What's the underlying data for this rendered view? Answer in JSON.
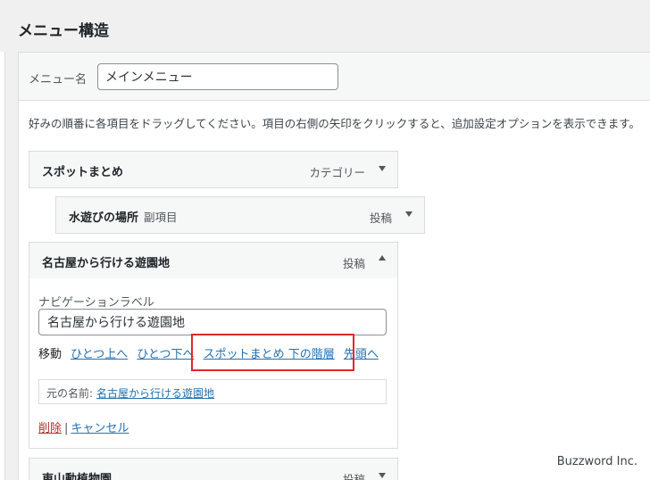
{
  "page": {
    "title": "メニュー構造"
  },
  "menu": {
    "name_label": "メニュー名",
    "name_value": "メインメニュー",
    "instruction": "好みの順番に各項目をドラッグしてください。項目の右側の矢印をクリックすると、追加設定オプションを表示できます。"
  },
  "items": [
    {
      "title": "スポットまとめ",
      "subtitle": "",
      "type": "カテゴリー",
      "expanded": false
    },
    {
      "title": "水遊びの場所",
      "subtitle": "副項目",
      "type": "投稿",
      "expanded": false
    },
    {
      "title": "名古屋から行ける遊園地",
      "subtitle": "",
      "type": "投稿",
      "expanded": true
    },
    {
      "title": "東山動植物園",
      "subtitle": "",
      "type": "投稿",
      "expanded": false
    }
  ],
  "settings": {
    "nav_label_caption": "ナビゲーションラベル",
    "nav_label_value": "名古屋から行ける遊園地",
    "move_label": "移動",
    "move_links": [
      "ひとつ上へ",
      "ひとつ下へ",
      "スポットまとめ 下の階層",
      "先頭へ"
    ],
    "original_caption": "元の名前:",
    "original_link": "名古屋から行ける遊園地",
    "delete_label": "削除",
    "separator": "|",
    "cancel_label": "キャンセル"
  },
  "watermark": "Buzzword Inc.",
  "colors": {
    "link": "#2271b1",
    "delete": "#b32d2e",
    "highlight": "#e0282c",
    "background": "#f0f0f1"
  }
}
